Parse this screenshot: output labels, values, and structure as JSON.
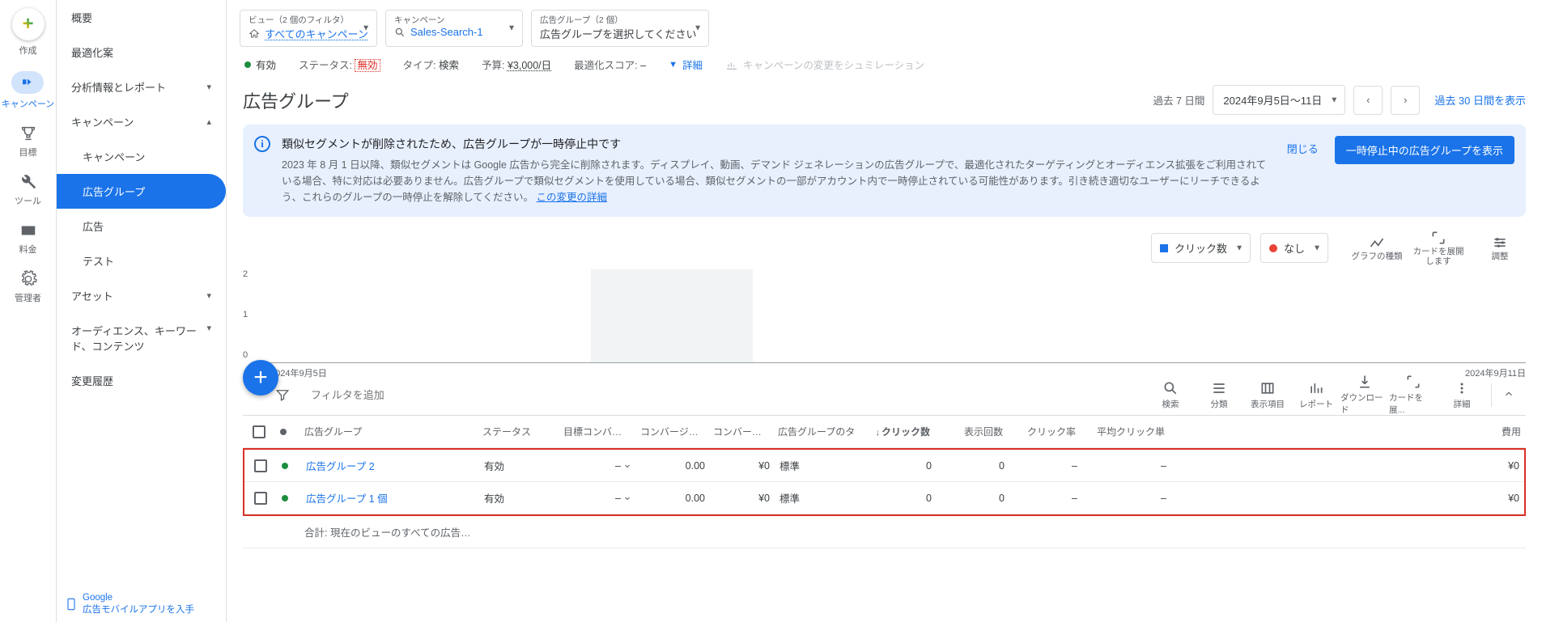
{
  "rail": [
    {
      "label": "作成",
      "icon": "plus"
    },
    {
      "label": "キャンペーン",
      "icon": "megaphone",
      "active": true
    },
    {
      "label": "目標",
      "icon": "trophy"
    },
    {
      "label": "ツール",
      "icon": "wrench"
    },
    {
      "label": "料金",
      "icon": "card"
    },
    {
      "label": "管理者",
      "icon": "gear"
    }
  ],
  "sidenav": {
    "items": [
      {
        "label": "概要"
      },
      {
        "label": "最適化案"
      },
      {
        "label": "分析情報とレポート",
        "expandable": true
      },
      {
        "label": "キャンペーン",
        "expandable": true,
        "expanded": true,
        "children": [
          {
            "label": "キャンペーン"
          },
          {
            "label": "広告グループ",
            "active": true
          },
          {
            "label": "広告"
          },
          {
            "label": "テスト"
          }
        ]
      },
      {
        "label": "アセット",
        "expandable": true
      },
      {
        "label": "オーディエンス、キーワード、コンテンツ",
        "expandable": true
      },
      {
        "label": "変更履歴"
      }
    ],
    "bottom": {
      "line1": "Google",
      "line2": "広告モバイルアプリを入手"
    }
  },
  "pathbar": {
    "view": {
      "label": "ビュー（2 個のフィルタ）",
      "value": "すべてのキャンペーン"
    },
    "campaign": {
      "label": "キャンペーン",
      "value": "Sales-Search-1"
    },
    "adgroup": {
      "label": "広告グループ（2 個）",
      "value": "広告グループを選択してください"
    }
  },
  "statusbar": {
    "enabled": "有効",
    "status_label": "ステータス:",
    "status_value": "無効",
    "type_label": "タイプ:",
    "type_value": "検索",
    "budget_label": "予算:",
    "budget_value": "¥3,000/日",
    "score_label": "最適化スコア:",
    "score_value": "–",
    "details": "詳細",
    "simulate": "キャンペーンの変更をシュミレーション"
  },
  "page_title": "広告グループ",
  "date": {
    "last7": "過去 7 日間",
    "range": "2024年9月5日～11日",
    "last30": "過去 30 日間を表示"
  },
  "banner": {
    "title": "類似セグメントが削除されたため、広告グループが一時停止中です",
    "body": "2023 年 8 月 1 日以降、類似セグメントは Google 広告から完全に削除されます。ディスプレイ、動画、デマンド ジェネレーションの広告グループで、最適化されたターゲティングとオーディエンス拡張をご利用されている場合、特に対応は必要ありません。広告グループで類似セグメントを使用している場合、類似セグメントの一部がアカウント内で一時停止されている可能性があります。引き続き適切なユーザーにリーチできるよう、これらのグループの一時停止を解除してください。",
    "link": "この変更の詳細",
    "close": "閉じる",
    "cta": "一時停止中の広告グループを表示"
  },
  "chart_controls": {
    "metric1": "クリック数",
    "metric2": "なし",
    "tools": [
      "グラフの種類",
      "カードを展開します",
      "調整"
    ]
  },
  "chart_data": {
    "type": "line",
    "x": [
      "2024年9月5日",
      "2024年9月11日"
    ],
    "series": [
      {
        "name": "クリック数",
        "values": [
          0,
          0
        ]
      }
    ],
    "ylim": [
      0,
      2
    ],
    "yticks": [
      0,
      1,
      2
    ]
  },
  "filter_placeholder": "フィルタを追加",
  "table_tools": [
    "検索",
    "分類",
    "表示項目",
    "レポート",
    "ダウンロード",
    "カードを展...",
    "詳細"
  ],
  "table": {
    "headers": [
      "",
      "",
      "広告グループ",
      "ステータス",
      "目標コンバージョン",
      "コンバージョン",
      "コンバージョン",
      "広告グループのタ",
      "クリック数",
      "表示回数",
      "クリック率",
      "平均クリック単",
      "費用"
    ],
    "sort_col": "クリック数",
    "rows": [
      {
        "name": "広告グループ 2",
        "status": "有効",
        "goal": "–",
        "conv1": "0.00",
        "conv2": "¥0",
        "type": "標準",
        "clicks": "0",
        "impr": "0",
        "ctr": "–",
        "cpc": "–",
        "cost": "¥0"
      },
      {
        "name": "広告グループ 1 個",
        "status": "有効",
        "goal": "–",
        "conv1": "0.00",
        "conv2": "¥0",
        "type": "標準",
        "clicks": "0",
        "impr": "0",
        "ctr": "–",
        "cpc": "–",
        "cost": "¥0"
      }
    ],
    "total_label": "合計: 現在のビューのすべての広告グル…"
  }
}
